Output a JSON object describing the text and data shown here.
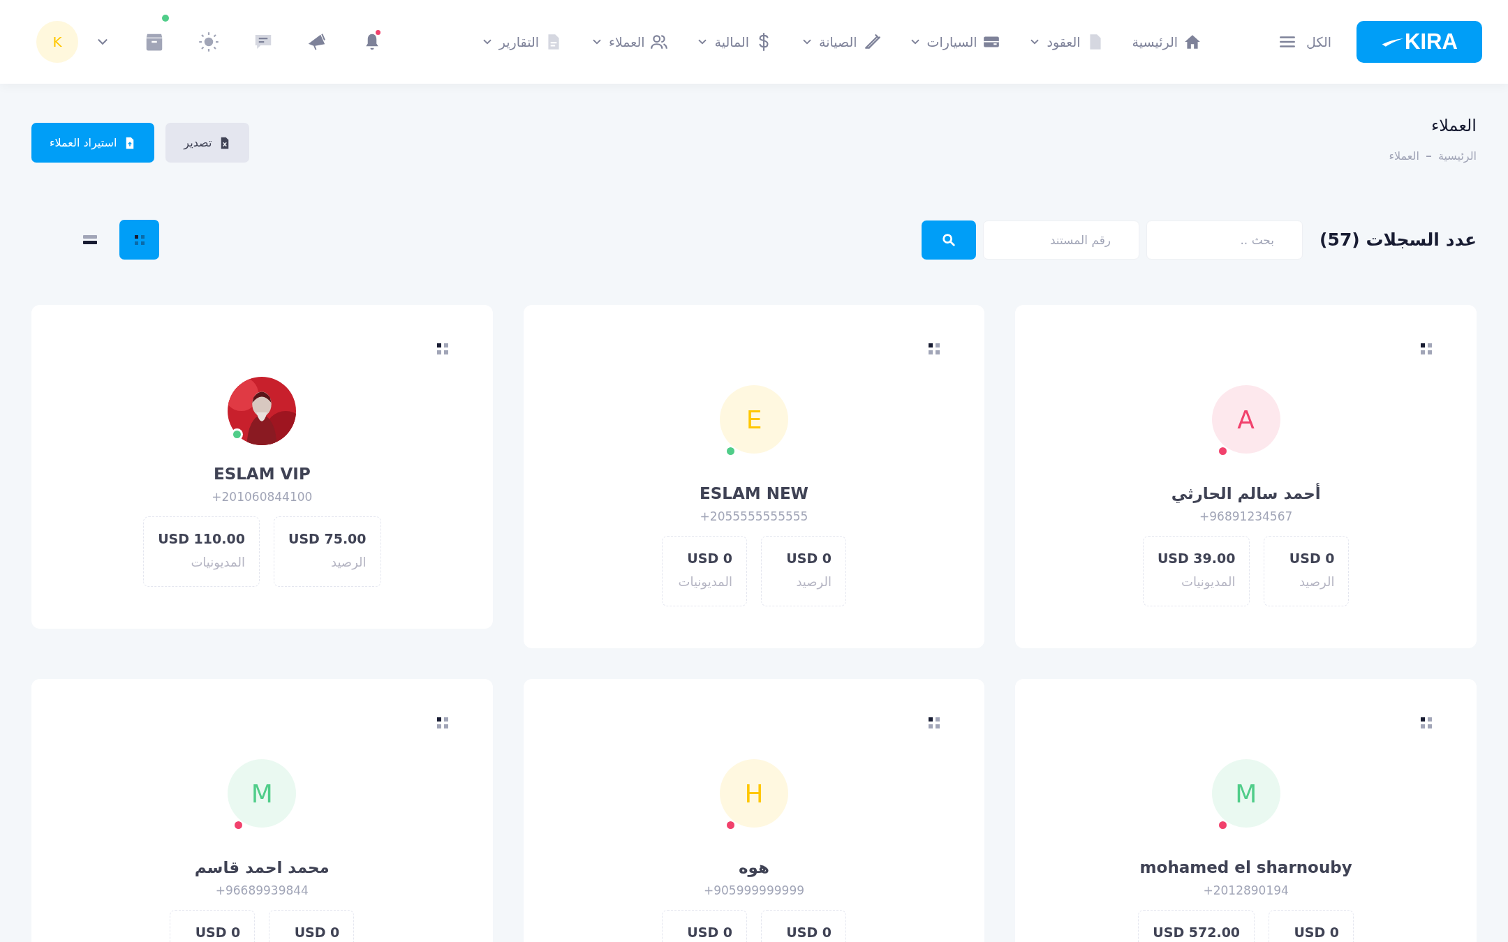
{
  "topbar": {
    "logo": "KIRA",
    "all_menu": "الكل",
    "nav": [
      {
        "label": "الرئيسية",
        "dropdown": false
      },
      {
        "label": "العقود",
        "dropdown": true
      },
      {
        "label": "السيارات",
        "dropdown": true
      },
      {
        "label": "الصيانة",
        "dropdown": true
      },
      {
        "label": "المالية",
        "dropdown": true
      },
      {
        "label": "العملاء",
        "dropdown": true
      },
      {
        "label": "التقارير",
        "dropdown": true
      }
    ],
    "tools": [
      {
        "dot": true,
        "color": "#f1416c"
      },
      {
        "dot": false
      },
      {
        "dot": false
      },
      {
        "dot": false
      },
      {
        "dot": true,
        "color": "#50cd89"
      }
    ],
    "user": {
      "initial": "K"
    }
  },
  "page": {
    "title": "العملاء",
    "breadcrumb": [
      "الرئيسية",
      "العملاء"
    ],
    "actions": [
      {
        "label": "تصدير",
        "kind": "secondary"
      },
      {
        "label": "استيراد العملاء",
        "kind": "primary"
      }
    ]
  },
  "toolbar": {
    "count": "عدد السجلات (57)",
    "search": {
      "placeholder": "بحث .."
    },
    "document": {
      "placeholder": "رقم المستند"
    },
    "views": [
      {
        "selected": true
      },
      {
        "selected": false
      }
    ]
  },
  "customers": [
    {
      "name": "أحمد سالم الحارثي",
      "phone": "+96891234567",
      "avatar": {
        "kind": "initial",
        "letter": "A",
        "color": "#f1416c"
      },
      "status": {
        "color": "#f1416c"
      },
      "stats": [
        {
          "value": "USD 0",
          "label": "الرصيد"
        },
        {
          "value": "USD 39.00",
          "label": "المديونيات"
        }
      ]
    },
    {
      "name": "ESLAM NEW",
      "phone": "+2055555555555",
      "avatar": {
        "kind": "initial",
        "letter": "E",
        "color": "#ffc700"
      },
      "status": {
        "color": "#50cd89"
      },
      "stats": [
        {
          "value": "USD 0",
          "label": "الرصيد"
        },
        {
          "value": "USD 0",
          "label": "المديونيات"
        }
      ]
    },
    {
      "name": "ESLAM VIP",
      "phone": "+201060844100",
      "status": {
        "color": "#50cd89"
      },
      "stats": [
        {
          "value": "USD 75.00",
          "label": "الرصيد"
        },
        {
          "value": "USD 110.00",
          "label": "المديونيات"
        }
      ]
    },
    {
      "name": "mohamed el sharnouby",
      "phone": "+2012890194",
      "avatar": {
        "kind": "initial",
        "letter": "M",
        "color": "#50cd89"
      },
      "status": {
        "color": "#f1416c"
      },
      "stats": [
        {
          "value": "USD 0"
        },
        {
          "value": "USD 572.00"
        }
      ]
    },
    {
      "name": "هوه",
      "phone": "+905999999999",
      "avatar": {
        "kind": "initial",
        "letter": "H",
        "color": "#ffc700"
      },
      "status": {
        "color": "#f1416c"
      },
      "stats": [
        {
          "value": "USD 0"
        },
        {
          "value": "USD 0"
        }
      ]
    },
    {
      "name": "محمد احمد قاسم",
      "phone": "+96689939844",
      "avatar": {
        "kind": "initial",
        "letter": "M",
        "color": "#50cd89"
      },
      "status": {
        "color": "#f1416c"
      },
      "stats": [
        {
          "value": "USD 0"
        },
        {
          "value": "USD 0"
        }
      ]
    }
  ]
}
